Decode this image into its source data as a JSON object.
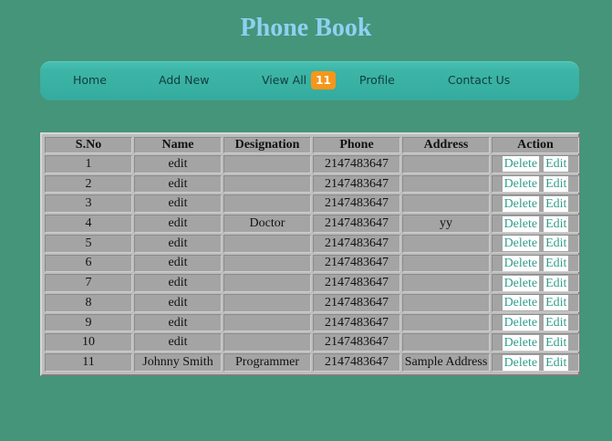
{
  "page": {
    "title": "Phone Book"
  },
  "nav": {
    "items": [
      {
        "label": "Home"
      },
      {
        "label": "Add New"
      },
      {
        "label": "View All"
      },
      {
        "label": "Profile"
      },
      {
        "label": "Contact Us"
      }
    ],
    "view_all_badge": "11",
    "badge_color": "#f7961a"
  },
  "table": {
    "headers": [
      "S.No",
      "Name",
      "Designation",
      "Phone",
      "Address",
      "Action"
    ],
    "delete_label": "Delete",
    "edit_label": "Edit",
    "rows": [
      {
        "sno": "1",
        "name": "edit",
        "designation": "",
        "phone": "2147483647",
        "address": ""
      },
      {
        "sno": "2",
        "name": "edit",
        "designation": "",
        "phone": "2147483647",
        "address": ""
      },
      {
        "sno": "3",
        "name": "edit",
        "designation": "",
        "phone": "2147483647",
        "address": ""
      },
      {
        "sno": "4",
        "name": "edit",
        "designation": "Doctor",
        "phone": "2147483647",
        "address": "yy"
      },
      {
        "sno": "5",
        "name": "edit",
        "designation": "",
        "phone": "2147483647",
        "address": ""
      },
      {
        "sno": "6",
        "name": "edit",
        "designation": "",
        "phone": "2147483647",
        "address": ""
      },
      {
        "sno": "7",
        "name": "edit",
        "designation": "",
        "phone": "2147483647",
        "address": ""
      },
      {
        "sno": "8",
        "name": "edit",
        "designation": "",
        "phone": "2147483647",
        "address": ""
      },
      {
        "sno": "9",
        "name": "edit",
        "designation": "",
        "phone": "2147483647",
        "address": ""
      },
      {
        "sno": "10",
        "name": "edit",
        "designation": "",
        "phone": "2147483647",
        "address": ""
      },
      {
        "sno": "11",
        "name": "Johnny Smith",
        "designation": "Programmer",
        "phone": "2147483647",
        "address": "Sample Address"
      }
    ]
  },
  "colors": {
    "background": "#449579",
    "title": "#8fd0f2",
    "nav": "#3cb5a7",
    "table": "#a4a4a4",
    "button_text": "#2f9d8a"
  }
}
